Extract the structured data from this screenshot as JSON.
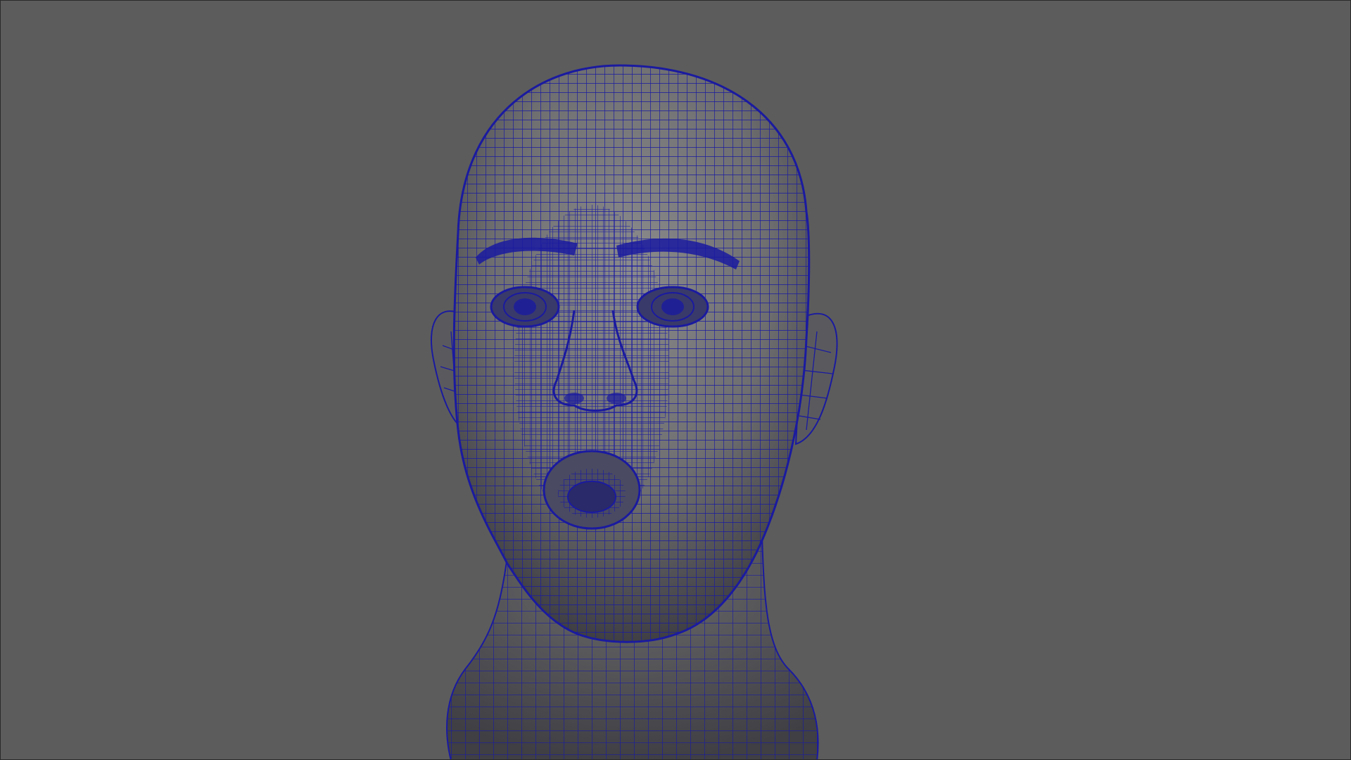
{
  "viewport": {
    "background_color": "#5c5c5c",
    "border_color": "#2a2a2a"
  },
  "model": {
    "subject": "head-wireframe-mesh",
    "surface_color": "#6e6e70",
    "surface_highlight": "#8a8a8c",
    "surface_shadow": "#3f3f44",
    "wireframe_color": "#1a1aa0",
    "display_mode": "wireframe-on-shaded"
  }
}
